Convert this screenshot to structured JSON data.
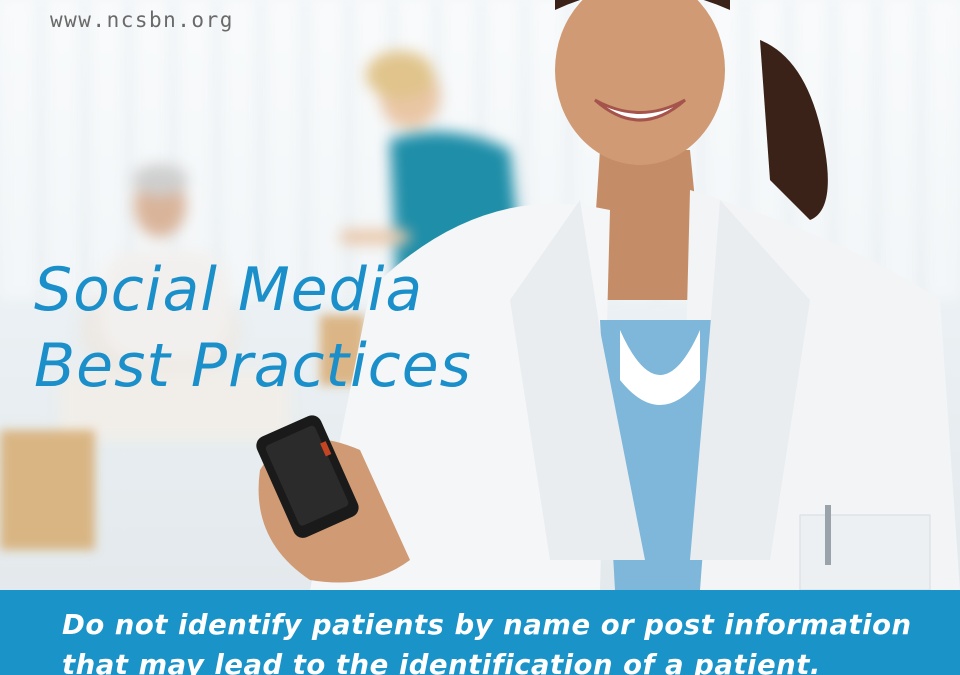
{
  "header": {
    "url": "www.ncsbn.org"
  },
  "headline": {
    "line1": "Social Media",
    "line2": "Best Practices"
  },
  "caption": {
    "line1": "Do not identify patients by name or post information",
    "line2": "that may lead to the identification of a patient."
  },
  "colors": {
    "accent": "#1a94c8",
    "headline": "#1a8fc9",
    "url": "#6a6a6a"
  }
}
